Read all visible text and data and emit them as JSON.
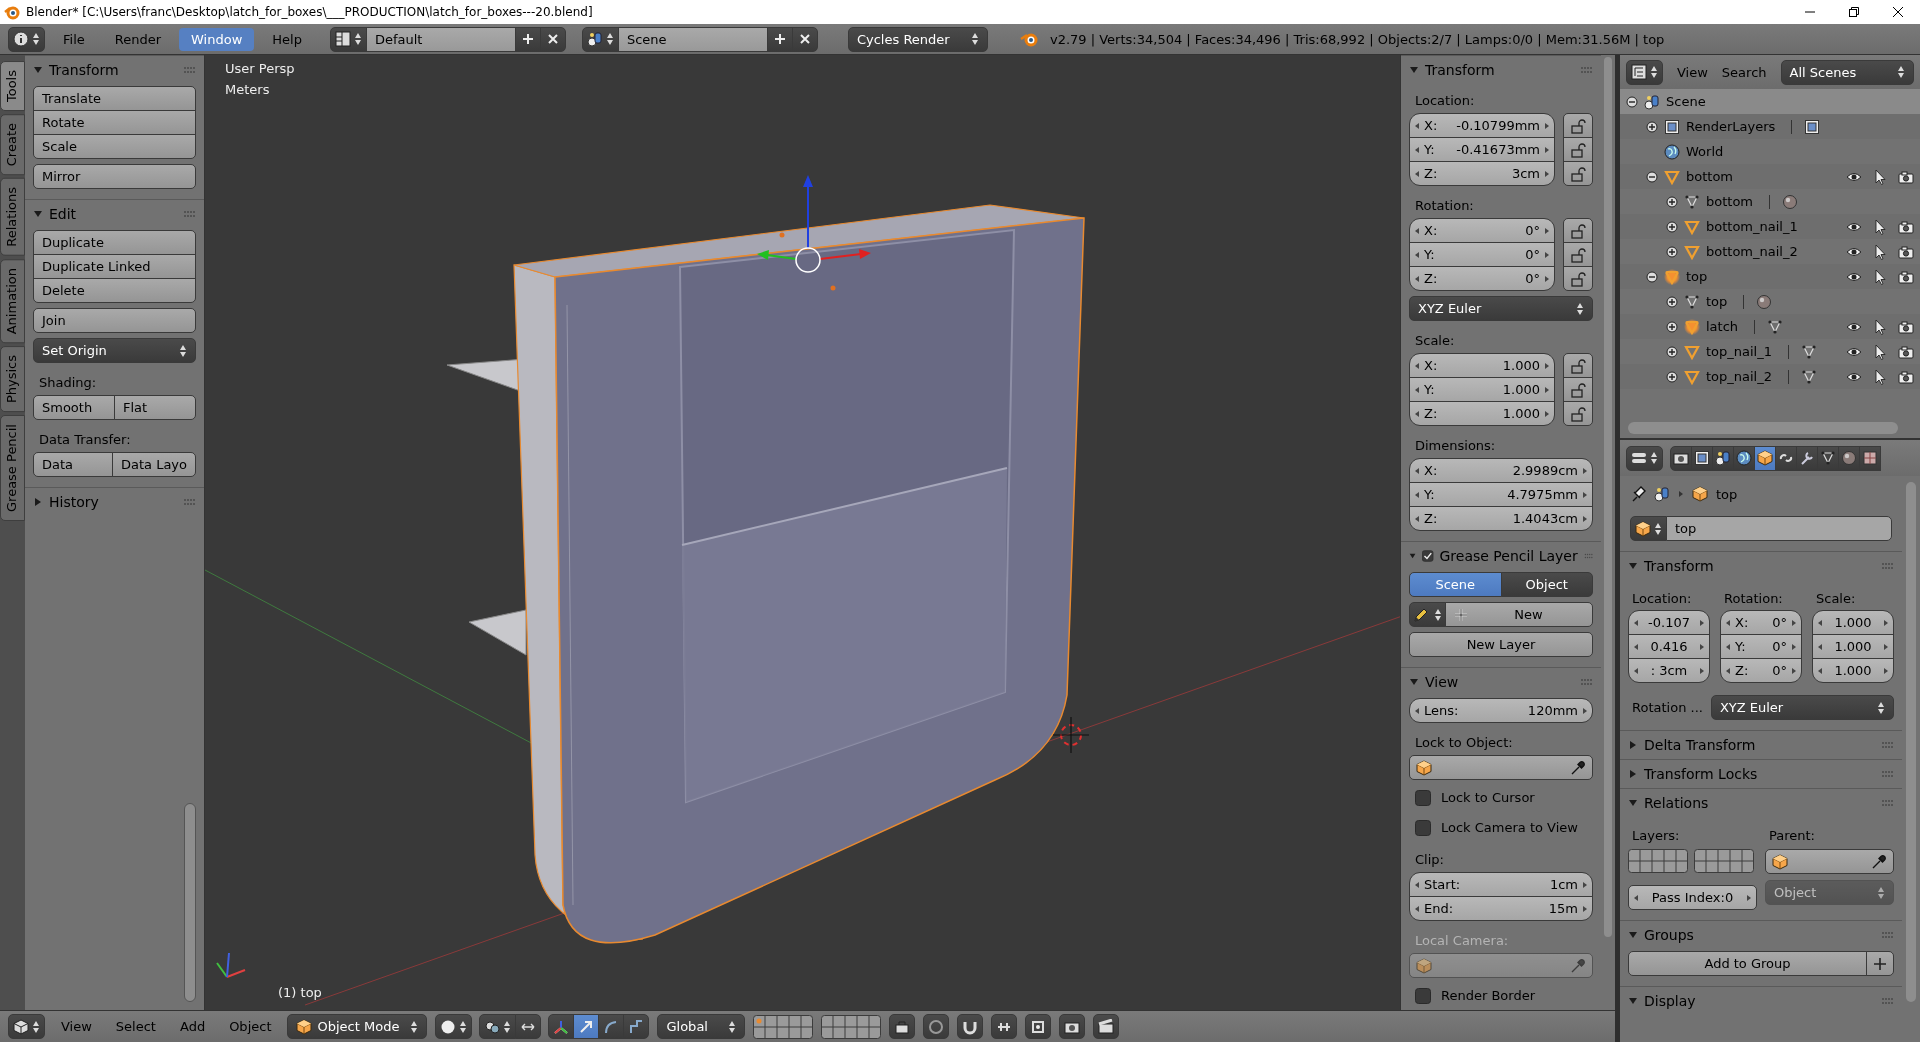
{
  "window": {
    "title": "Blender* [C:\\Users\\franc\\Desktop\\latch_for_boxes\\___PRODUCTION\\latch_for_boxes---20.blend]"
  },
  "info_header": {
    "menus": [
      {
        "label": "File",
        "selected": false
      },
      {
        "label": "Render",
        "selected": false
      },
      {
        "label": "Window",
        "selected": true
      },
      {
        "label": "Help",
        "selected": false
      }
    ],
    "screen_layout": "Default",
    "scene": "Scene",
    "render_engine": "Cycles Render",
    "stats": "v2.79 | Verts:34,504 | Faces:34,496 | Tris:68,992 | Objects:2/7 | Lamps:0/0 | Mem:31.56M | top"
  },
  "tool_tabs": [
    {
      "label": "Tools",
      "selected": true
    },
    {
      "label": "Create",
      "selected": false
    },
    {
      "label": "Relations",
      "selected": false
    },
    {
      "label": "Animation",
      "selected": false
    },
    {
      "label": "Physics",
      "selected": false
    },
    {
      "label": "Grease Pencil",
      "selected": false
    }
  ],
  "tool_shelf": {
    "panels": [
      {
        "title": "Transform",
        "expanded": true,
        "items": [
          {
            "kind": "button_group",
            "buttons": [
              "Translate",
              "Rotate",
              "Scale"
            ]
          },
          {
            "kind": "button_group",
            "buttons": [
              "Mirror"
            ]
          }
        ]
      },
      {
        "title": "Edit",
        "expanded": true,
        "items": [
          {
            "kind": "button_group",
            "buttons": [
              "Duplicate",
              "Duplicate Linked",
              "Delete"
            ]
          },
          {
            "kind": "button_group",
            "buttons": [
              "Join"
            ]
          },
          {
            "kind": "dropdown",
            "value": "Set Origin"
          },
          {
            "kind": "label",
            "text": "Shading:",
            "disabled": false
          },
          {
            "kind": "button_row",
            "buttons": [
              "Smooth",
              "Flat"
            ]
          },
          {
            "kind": "label",
            "text": "Data Transfer:",
            "disabled": false
          },
          {
            "kind": "button_row",
            "buttons": [
              "Data",
              "Data Layo"
            ]
          }
        ]
      },
      {
        "title": "History",
        "expanded": false
      }
    ]
  },
  "viewport": {
    "view_name": "User Persp",
    "units": "Meters",
    "object_label": "(1) top"
  },
  "npanel": {
    "panels": [
      {
        "title": "Transform",
        "expanded": true,
        "items": [
          {
            "kind": "label",
            "text": "Location:",
            "disabled": false
          },
          {
            "kind": "fields",
            "locks": true,
            "fields": [
              {
                "label": "X:",
                "value": "-0.10799mm"
              },
              {
                "label": "Y:",
                "value": "-0.41673mm"
              },
              {
                "label": "Z:",
                "value": "3cm"
              }
            ]
          },
          {
            "kind": "label",
            "text": "Rotation:",
            "disabled": false
          },
          {
            "kind": "fields",
            "locks": true,
            "fields": [
              {
                "label": "X:",
                "value": "0°"
              },
              {
                "label": "Y:",
                "value": "0°"
              },
              {
                "label": "Z:",
                "value": "0°"
              }
            ]
          },
          {
            "kind": "dropdown",
            "value": "XYZ Euler"
          },
          {
            "kind": "label",
            "text": "Scale:",
            "disabled": false
          },
          {
            "kind": "fields",
            "locks": true,
            "fields": [
              {
                "label": "X:",
                "value": "1.000"
              },
              {
                "label": "Y:",
                "value": "1.000"
              },
              {
                "label": "Z:",
                "value": "1.000"
              }
            ]
          },
          {
            "kind": "label",
            "text": "Dimensions:",
            "disabled": false
          },
          {
            "kind": "fields",
            "locks": false,
            "fields": [
              {
                "label": "X:",
                "value": "2.9989cm"
              },
              {
                "label": "Y:",
                "value": "4.7975mm"
              },
              {
                "label": "Z:",
                "value": "1.4043cm"
              }
            ]
          }
        ]
      },
      {
        "title": "Grease Pencil Layer",
        "expanded": true,
        "checked": true,
        "items": [
          {
            "kind": "tabs",
            "options": [
              {
                "label": "Scene",
                "selected": true
              },
              {
                "label": "Object",
                "selected": false
              }
            ]
          },
          {
            "kind": "new_row",
            "label": "New"
          },
          {
            "kind": "button",
            "label": "New Layer"
          }
        ]
      },
      {
        "title": "View",
        "expanded": true,
        "items": [
          {
            "kind": "fields",
            "locks": false,
            "fields": [
              {
                "label": "Lens:",
                "value": "120mm"
              }
            ]
          },
          {
            "kind": "label",
            "text": "Lock to Object:",
            "disabled": false
          },
          {
            "kind": "object_field",
            "disabled": false
          },
          {
            "kind": "checkbox",
            "label": "Lock to Cursor",
            "checked": false
          },
          {
            "kind": "checkbox",
            "label": "Lock Camera to View",
            "checked": false
          },
          {
            "kind": "label",
            "text": "Clip:",
            "disabled": false
          },
          {
            "kind": "fields",
            "locks": false,
            "fields": [
              {
                "label": "Start:",
                "value": "1cm"
              },
              {
                "label": "End:",
                "value": "15m"
              }
            ]
          },
          {
            "kind": "label",
            "text": "Local Camera:",
            "disabled": true
          },
          {
            "kind": "object_field",
            "disabled": true
          },
          {
            "kind": "checkbox",
            "label": "Render Border",
            "checked": false
          }
        ]
      }
    ]
  },
  "outliner": {
    "menus": [
      "View",
      "Search"
    ],
    "display_mode": "All Scenes",
    "tree": [
      {
        "name": "Scene",
        "kind": "scene",
        "expanded": true,
        "selected": true,
        "children": [
          {
            "name": "RenderLayers",
            "kind": "renderlayers",
            "expanded": false,
            "selected": false,
            "sub_items": [
              {
                "kind": "renderlayers"
              }
            ]
          },
          {
            "name": "World",
            "kind": "world",
            "selected": false
          },
          {
            "name": "bottom",
            "kind": "object",
            "expanded": true,
            "selected": false,
            "children": [
              {
                "name": "bottom",
                "kind": "mesh",
                "expanded": false,
                "selected": false,
                "sub_items": [
                  {
                    "kind": "material"
                  }
                ]
              },
              {
                "name": "bottom_nail_1",
                "kind": "object",
                "expanded": false,
                "selected": false
              },
              {
                "name": "bottom_nail_2",
                "kind": "object",
                "expanded": false,
                "selected": false
              }
            ]
          },
          {
            "name": "top",
            "kind": "object",
            "expanded": true,
            "selected": true,
            "children": [
              {
                "name": "top",
                "kind": "mesh",
                "expanded": false,
                "selected": false,
                "sub_items": [
                  {
                    "kind": "material"
                  }
                ]
              },
              {
                "name": "latch",
                "kind": "object",
                "expanded": false,
                "selected": true,
                "sub_items": [
                  {
                    "kind": "mesh"
                  }
                ]
              },
              {
                "name": "top_nail_1",
                "kind": "object",
                "expanded": false,
                "selected": false,
                "sub_items": [
                  {
                    "kind": "mesh"
                  }
                ]
              },
              {
                "name": "top_nail_2",
                "kind": "object",
                "expanded": false,
                "selected": false,
                "sub_items": [
                  {
                    "kind": "mesh"
                  }
                ]
              }
            ]
          }
        ]
      }
    ]
  },
  "properties": {
    "context_tabs": [
      {
        "kind": "render",
        "selected": false
      },
      {
        "kind": "layers",
        "selected": false
      },
      {
        "kind": "scene",
        "selected": false
      },
      {
        "kind": "world",
        "selected": false
      },
      {
        "kind": "object",
        "selected": true
      },
      {
        "kind": "constraints",
        "selected": false
      },
      {
        "kind": "modifiers",
        "selected": false
      },
      {
        "kind": "data",
        "selected": false
      },
      {
        "kind": "material",
        "selected": false
      },
      {
        "kind": "texture",
        "selected": false
      }
    ],
    "breadcrumb": "top",
    "object_name": "top",
    "panels": [
      {
        "title": "Transform",
        "kind": "transform",
        "expanded": true,
        "columns": [
          {
            "label": "Location:",
            "fields": [
              {
                "value": "-0.107"
              },
              {
                "value": "0.416"
              },
              {
                "value": ": 3cm"
              }
            ]
          },
          {
            "label": "Rotation:",
            "fields": [
              {
                "label": "X:",
                "value": "0°"
              },
              {
                "label": "Y:",
                "value": "0°"
              },
              {
                "label": "Z:",
                "value": "0°"
              }
            ]
          },
          {
            "label": "Scale:",
            "fields": [
              {
                "value": "1.000"
              },
              {
                "value": "1.000"
              },
              {
                "value": "1.000"
              }
            ]
          }
        ],
        "mode_label": "Rotation ...",
        "mode": "XYZ Euler"
      },
      {
        "title": "Delta Transform",
        "expanded": false
      },
      {
        "title": "Transform Locks",
        "expanded": false
      },
      {
        "title": "Relations",
        "kind": "relations",
        "expanded": true,
        "layers_label": "Layers:",
        "parent_label": "Parent:",
        "parent_type": {
          "value": "Object",
          "disabled": true
        },
        "pass_index": "Pass Index:0"
      },
      {
        "title": "Groups",
        "kind": "groups",
        "expanded": true,
        "button": "Add to Group"
      },
      {
        "title": "Display",
        "expanded": true
      }
    ]
  },
  "view_header": {
    "menus": [
      "View",
      "Select",
      "Add",
      "Object"
    ],
    "mode": "Object Mode",
    "manipulators": [
      {
        "kind": "toggle",
        "selected": false
      },
      {
        "kind": "translate",
        "selected": true
      },
      {
        "kind": "rotate",
        "selected": false
      },
      {
        "kind": "scale",
        "selected": false
      }
    ],
    "orientation": "Global"
  }
}
